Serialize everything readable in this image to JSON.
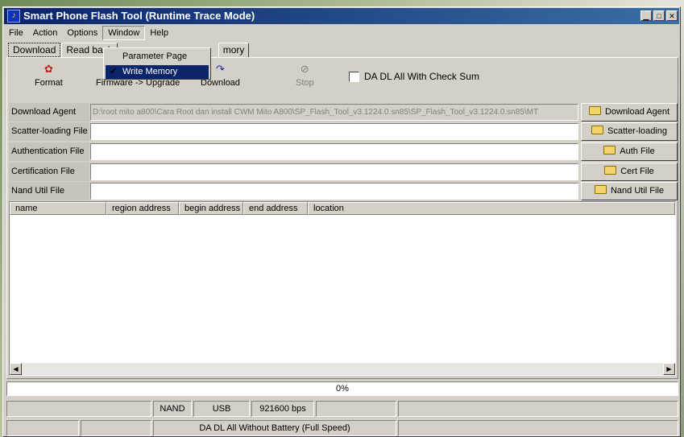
{
  "window": {
    "title": "Smart Phone Flash Tool (Runtime Trace Mode)"
  },
  "menus": [
    "File",
    "Action",
    "Options",
    "Window",
    "Help"
  ],
  "tabs": [
    "Download",
    "Read back",
    "mory"
  ],
  "dropdown": {
    "items": [
      "Parameter Page",
      "Write Memory"
    ]
  },
  "toolbar": {
    "format": "Format",
    "firmware": "Firmware -> Upgrade",
    "download": "Download",
    "stop": "Stop",
    "checksum_label": "DA DL All With Check Sum"
  },
  "fields": [
    {
      "label": "Download Agent",
      "value": "D:\\root mito a800\\Cara Root dan install CWM Mito A800\\SP_Flash_Tool_v3.1224.0.sn85\\SP_Flash_Tool_v3.1224.0.sn85\\MT",
      "button": "Download Agent"
    },
    {
      "label": "Scatter-loading File",
      "value": "",
      "button": "Scatter-loading"
    },
    {
      "label": "Authentication File",
      "value": "",
      "button": "Auth File"
    },
    {
      "label": "Certification File",
      "value": "",
      "button": "Cert File"
    },
    {
      "label": "Nand Util File",
      "value": "",
      "button": "Nand Util File"
    }
  ],
  "table": {
    "columns": [
      "name",
      "region address",
      "begin address",
      "end address",
      "location"
    ]
  },
  "progress": {
    "text": "0%"
  },
  "status": {
    "storage": "NAND",
    "conn": "USB",
    "baud": "921600 bps",
    "mode": "DA DL All Without Battery (Full Speed)"
  }
}
